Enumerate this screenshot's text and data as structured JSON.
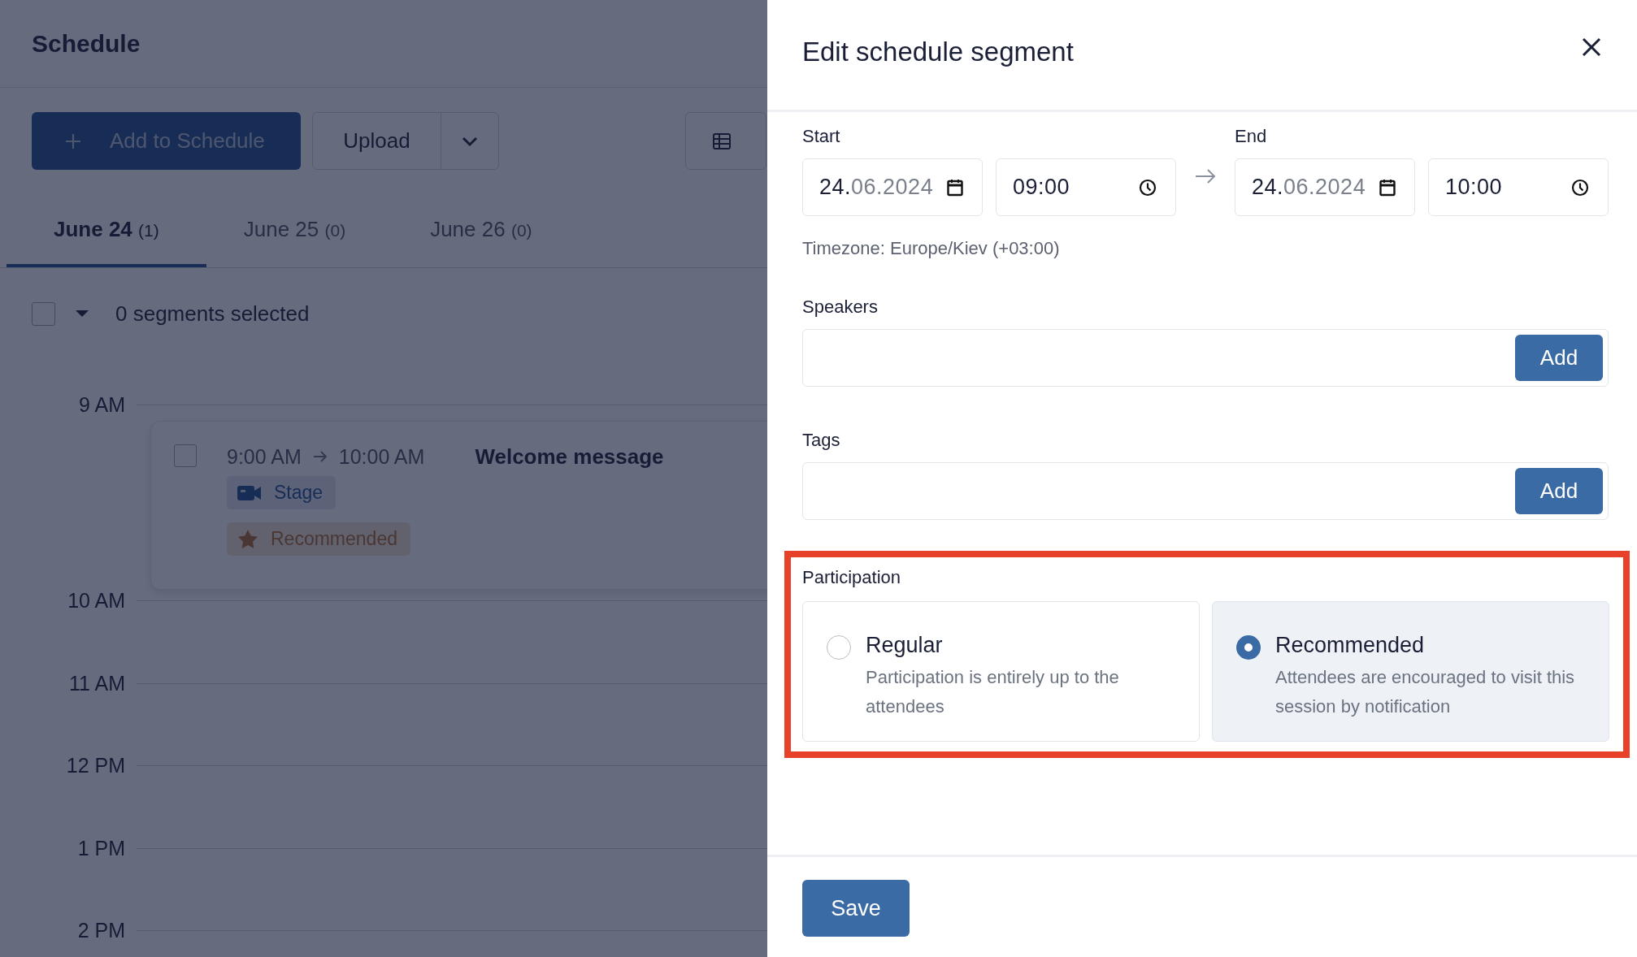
{
  "page": {
    "title": "Schedule",
    "add_button": {
      "label": "Add to Schedule"
    },
    "upload_button": {
      "label": "Upload"
    },
    "tabs": [
      {
        "label": "June 24",
        "count": "(1)",
        "selected": true
      },
      {
        "label": "June 25",
        "count": "(0)",
        "selected": false
      },
      {
        "label": "June 26",
        "count": "(0)",
        "selected": false
      }
    ],
    "selection": {
      "checked": false,
      "text": "0 segments selected"
    },
    "timeline": {
      "hours": [
        {
          "label": "9 AM",
          "segments": [
            {
              "checked": false,
              "start": "9:00 AM",
              "end": "10:00 AM",
              "title": "Welcome message",
              "tags": [
                {
                  "kind": "stage",
                  "label": "Stage"
                },
                {
                  "kind": "recommended",
                  "label": "Recommended"
                }
              ]
            }
          ]
        },
        {
          "label": "10 AM"
        },
        {
          "label": "11 AM"
        },
        {
          "label": "12 PM"
        },
        {
          "label": "1 PM"
        },
        {
          "label": "2 PM"
        }
      ]
    }
  },
  "drawer": {
    "title": "Edit schedule segment",
    "start": {
      "label": "Start",
      "date": "24.06.2024",
      "time": "09:00"
    },
    "end": {
      "label": "End",
      "date": "24.06.2024",
      "time": "10:00"
    },
    "timezone": "Timezone: Europe/Kiev (+03:00)",
    "speakers": {
      "label": "Speakers",
      "button": "Add"
    },
    "tags": {
      "label": "Tags",
      "button": "Add"
    },
    "participation": {
      "label": "Participation",
      "options": [
        {
          "title": "Regular",
          "description": "Participation is entirely up to the attendees",
          "selected": false
        },
        {
          "title": "Recommended",
          "description": "Attendees are encouraged to visit this session by notification",
          "selected": true
        }
      ]
    },
    "save_button": "Save"
  }
}
